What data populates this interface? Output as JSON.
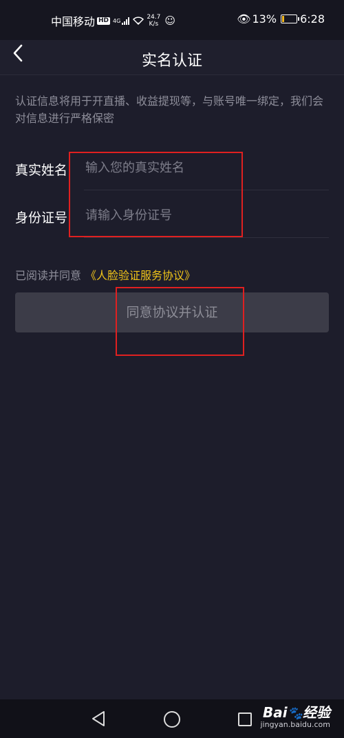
{
  "status_bar": {
    "carrier": "中国移动",
    "hd": "HD",
    "network": "4G",
    "speed_value": "24.7",
    "speed_unit": "K/s",
    "battery": "13%",
    "time": "6:28"
  },
  "header": {
    "title": "实名认证"
  },
  "notice": "认证信息将用于开直播、收益提现等，与账号唯一绑定，我们会对信息进行严格保密",
  "form": {
    "name_label": "真实姓名",
    "name_placeholder": "输入您的真实姓名",
    "name_value": "",
    "id_label": "身份证号",
    "id_placeholder": "请输入身份证号",
    "id_value": ""
  },
  "agreement": {
    "prefix": "已阅读并同意",
    "link": "《人脸验证服务协议》"
  },
  "submit_label": "同意协议并认证",
  "watermark": {
    "brand_left": "Bai",
    "brand_paw": "🐾",
    "brand_right": "经验",
    "url": "jingyan.baidu.com"
  },
  "colors": {
    "background": "#1d1d2b",
    "accent_link": "#f0c419",
    "annotation": "#e02020",
    "button_bg": "#3c3c48"
  }
}
